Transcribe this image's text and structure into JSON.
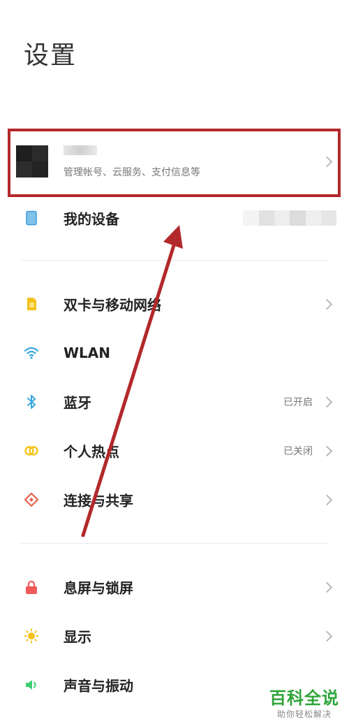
{
  "header": {
    "title": "设置"
  },
  "account": {
    "subtitle": "管理帐号、云服务、支付信息等"
  },
  "rows": [
    {
      "label": "我的设备",
      "value": "",
      "icon": "device-icon"
    },
    {
      "label": "双卡与移动网络",
      "value": "",
      "icon": "sim-card-icon"
    },
    {
      "label": "WLAN",
      "value": "",
      "icon": "wifi-icon"
    },
    {
      "label": "蓝牙",
      "value": "已开启",
      "icon": "bluetooth-icon"
    },
    {
      "label": "个人热点",
      "value": "已关闭",
      "icon": "hotspot-icon"
    },
    {
      "label": "连接与共享",
      "value": "",
      "icon": "share-icon"
    },
    {
      "label": "息屏与锁屏",
      "value": "",
      "icon": "lock-icon"
    },
    {
      "label": "显示",
      "value": "",
      "icon": "brightness-icon"
    },
    {
      "label": "声音与振动",
      "value": "",
      "icon": "speaker-icon"
    }
  ],
  "colors": {
    "annotation_red": "#b3282b",
    "brand_green": "#2ea43a",
    "wifi_blue": "#3aa7e0",
    "sim_yellow": "#f4c21b",
    "lock_red": "#ef5a5a"
  },
  "watermark": {
    "main": "百科全说",
    "sub": "助你轻松解决"
  }
}
